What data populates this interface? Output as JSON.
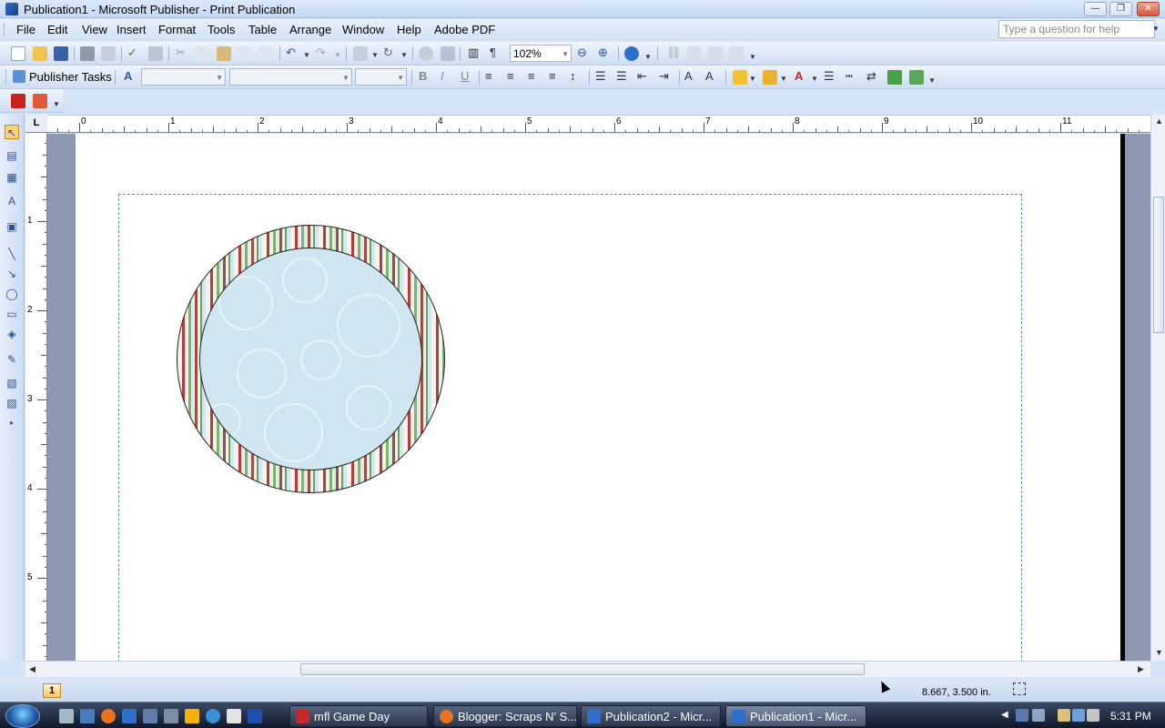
{
  "window": {
    "title": "Publication1 - Microsoft Publisher - Print Publication",
    "minimize": "—",
    "maximize": "❐",
    "close": "✕"
  },
  "menu": {
    "items": [
      "File",
      "Edit",
      "View",
      "Insert",
      "Format",
      "Tools",
      "Table",
      "Arrange",
      "Window",
      "Help",
      "Adobe PDF"
    ],
    "help_placeholder": "Type a question for help"
  },
  "standard_toolbar": {
    "zoom": "102%",
    "icons": [
      "new-icon",
      "open-icon",
      "save-icon",
      "print-icon",
      "print-preview-icon",
      "spelling-icon",
      "research-icon",
      "cut-icon",
      "copy-icon",
      "paste-icon",
      "format-painter-icon",
      "undo-icon",
      "redo-icon",
      "bring-to-front-icon",
      "rotate-icon",
      "hyperlink-icon",
      "zoom-icon",
      "columns-icon",
      "pilcrow-icon",
      "zoom-out-icon",
      "zoom-in-icon",
      "help-icon"
    ]
  },
  "formatting_toolbar": {
    "publisher_tasks": "Publisher Tasks",
    "style_value": "",
    "font_value": "",
    "size_value": "",
    "bold": "B",
    "italic": "I",
    "underline": "U"
  },
  "ruler": {
    "corner": "L",
    "h_labels": [
      "0",
      "1",
      "2",
      "3",
      "4",
      "5",
      "6",
      "7",
      "8",
      "9",
      "10",
      "11"
    ],
    "v_labels": [
      "1",
      "2",
      "3",
      "4",
      "5"
    ]
  },
  "status": {
    "page_number": "1",
    "coordinates": "8.667, 3.500 in."
  },
  "taskbar": {
    "buttons": [
      {
        "label": "mfl Game Day",
        "color": "#c62828"
      },
      {
        "label": "Blogger: Scraps N' S...",
        "color": "#e8731c"
      },
      {
        "label": "Publication2 - Micr...",
        "color": "#2f6fc9"
      },
      {
        "label": "Publication1 - Micr...",
        "color": "#2f6fc9"
      }
    ],
    "clock": "5:31 PM"
  },
  "colors": {
    "stripe_red": "#b63c36",
    "stripe_green": "#7fb36a",
    "inner_blue": "#cfe6f1"
  }
}
